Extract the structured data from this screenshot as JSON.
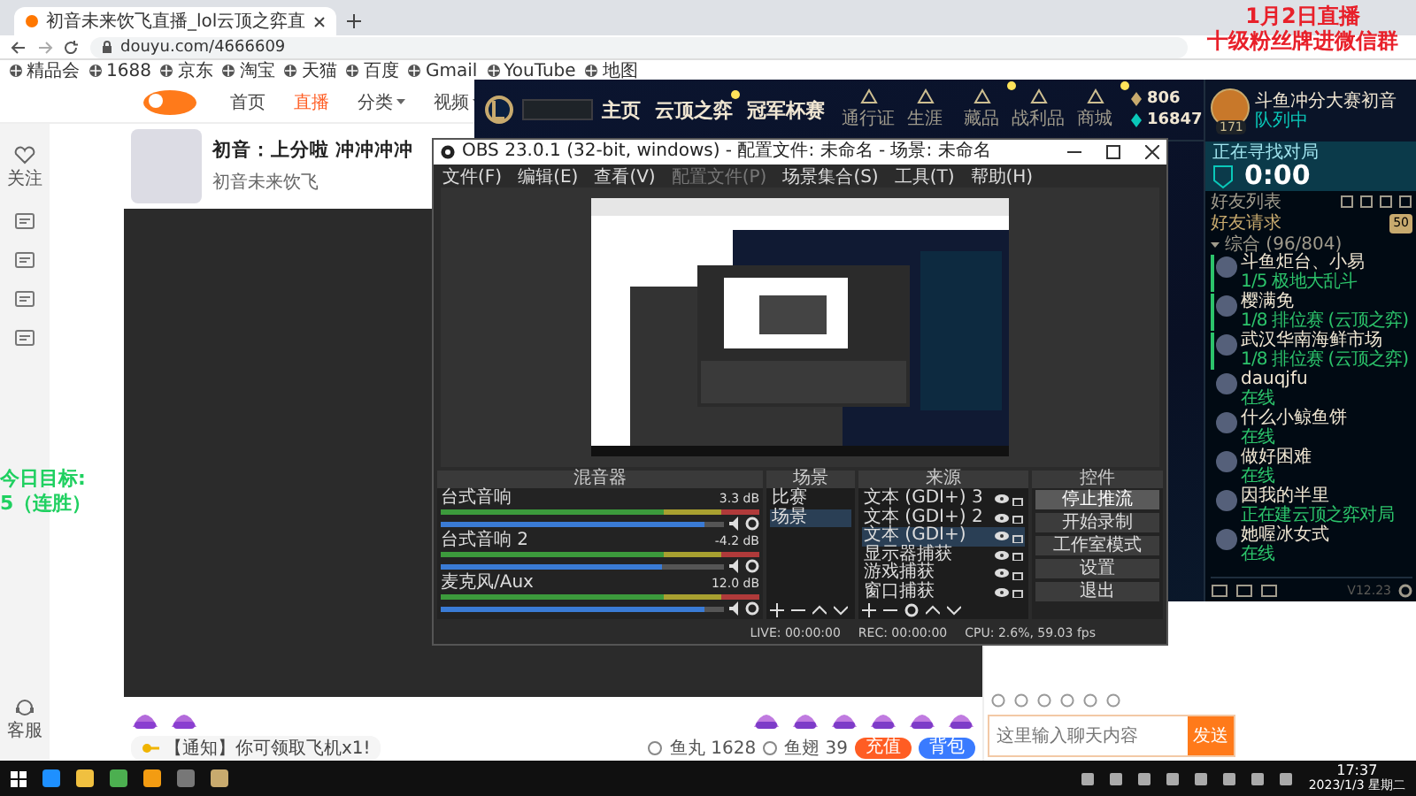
{
  "browser": {
    "tab_title": "初音未来饮飞直播_lol云顶之弈直",
    "url": "douyu.com/4666609",
    "bookmarks": [
      "精品会",
      "1688",
      "京东",
      "淘宝",
      "天猫",
      "百度",
      "Gmail",
      "YouTube",
      "地图"
    ]
  },
  "overlay": {
    "lines": [
      "1月2日直播",
      "十级粉丝牌进微信群"
    ],
    "goal": [
      "今日目标:",
      "5（连胜）"
    ]
  },
  "douyu": {
    "nav": [
      {
        "label": "首页",
        "selected": false,
        "dropdown": false
      },
      {
        "label": "直播",
        "selected": true,
        "dropdown": false
      },
      {
        "label": "分类",
        "selected": false,
        "dropdown": true
      },
      {
        "label": "视频",
        "selected": false,
        "dropdown": true
      }
    ],
    "sidebar": {
      "top": "关注",
      "bottom": "客服"
    },
    "room": {
      "title": "初音：上分啦 冲冲冲冲",
      "streamer": "初音未来饮飞"
    },
    "notice": "【通知】你可领取飞机x1!",
    "wallet": [
      {
        "label": "鱼丸",
        "value": "1628"
      },
      {
        "label": "鱼翅",
        "value": "39"
      }
    ],
    "wallet_buttons": [
      "充值",
      "背包"
    ],
    "chat": {
      "placeholder": "这里输入聊天内容",
      "send": "发送"
    }
  },
  "lol": {
    "nav": [
      {
        "label": "主页",
        "dot": false
      },
      {
        "label": "云顶之弈",
        "dot": true
      },
      {
        "label": "冠军杯赛",
        "dot": false
      }
    ],
    "tools": [
      {
        "label": "通行证",
        "dot": false
      },
      {
        "label": "生涯",
        "dot": false
      },
      {
        "label": "藏品",
        "dot": true
      },
      {
        "label": "战利品",
        "dot": false
      },
      {
        "label": "商城",
        "dot": true
      }
    ],
    "currency": [
      "806",
      "16847"
    ],
    "profile": {
      "name": "斗鱼冲分大赛初音",
      "status": "队列中",
      "level": "171"
    },
    "queue": {
      "title": "正在寻找对局",
      "time": "0:00"
    },
    "friends": {
      "title": "好友列表",
      "requests": "好友请求",
      "request_count": "50",
      "group": "综合 (96/804)",
      "list": [
        {
          "name": "斗鱼炬台、小易",
          "status": "1/5 极地大乱斗",
          "in_game": true
        },
        {
          "name": "樱满免",
          "status": "1/8 排位赛 (云顶之弈)",
          "in_game": true
        },
        {
          "name": "武汉华南海鲜市场",
          "status": "1/8 排位赛 (云顶之弈)",
          "in_game": true
        },
        {
          "name": "dauqjfu",
          "status": "在线",
          "in_game": false
        },
        {
          "name": "什么小鲸鱼饼",
          "status": "在线",
          "in_game": false
        },
        {
          "name": "做好困难",
          "status": "在线",
          "in_game": false
        },
        {
          "name": "因我的半里",
          "status": "正在建云顶之弈对局",
          "in_game": false
        },
        {
          "name": "她喔冰女式",
          "status": "在线",
          "in_game": false
        }
      ],
      "version": "V12.23"
    }
  },
  "obs": {
    "title": "OBS 23.0.1 (32-bit, windows) - 配置文件: 未命名 - 场景: 未命名",
    "menu": [
      {
        "label": "文件(F)",
        "disabled": false
      },
      {
        "label": "编辑(E)",
        "disabled": false
      },
      {
        "label": "查看(V)",
        "disabled": false
      },
      {
        "label": "配置文件(P)",
        "disabled": true
      },
      {
        "label": "场景集合(S)",
        "disabled": false
      },
      {
        "label": "工具(T)",
        "disabled": false
      },
      {
        "label": "帮助(H)",
        "disabled": false
      }
    ],
    "docks": [
      "混音器",
      "场景",
      "来源",
      "控件"
    ],
    "mixer": [
      {
        "name": "台式音响",
        "reading": "3.3 dB",
        "level": 0.93
      },
      {
        "name": "台式音响 2",
        "reading": "-4.2 dB",
        "level": 0.78
      },
      {
        "name": "麦克风/Aux",
        "reading": "12.0 dB",
        "level": 0.93
      }
    ],
    "scenes": [
      {
        "label": "比赛",
        "selected": false
      },
      {
        "label": "场景",
        "selected": true
      }
    ],
    "sources": [
      {
        "label": "文本 (GDI+) 3",
        "selected": false
      },
      {
        "label": "文本 (GDI+) 2",
        "selected": false
      },
      {
        "label": "文本 (GDI+)",
        "selected": true
      },
      {
        "label": "显示器捕获",
        "selected": false
      },
      {
        "label": "游戏捕获",
        "selected": false
      },
      {
        "label": "窗口捕获",
        "selected": false
      }
    ],
    "controls": [
      {
        "label": "停止推流",
        "active": true
      },
      {
        "label": "开始录制",
        "active": false
      },
      {
        "label": "工作室模式",
        "active": false
      },
      {
        "label": "设置",
        "active": false
      },
      {
        "label": "退出",
        "active": false
      }
    ],
    "status": [
      "LIVE: 00:00:00",
      "REC: 00:00:00",
      "CPU: 2.6%, 59.03 fps"
    ]
  },
  "taskbar": {
    "time": "17:37",
    "date": "2023/1/3 星期二"
  }
}
